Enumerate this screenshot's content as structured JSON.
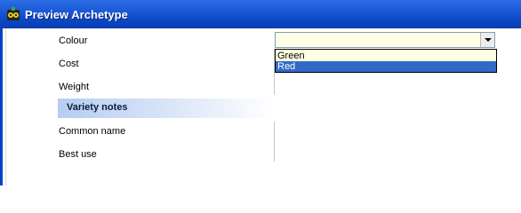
{
  "window": {
    "title": "Preview Archetype",
    "icon": "app-icon",
    "accent_color": "#0a48c6"
  },
  "form": {
    "rows": [
      {
        "label": "Colour"
      },
      {
        "label": "Cost"
      },
      {
        "label": "Weight"
      }
    ],
    "section": {
      "label": "Variety notes"
    },
    "section_rows": [
      {
        "label": "Common name"
      },
      {
        "label": "Best use"
      }
    ]
  },
  "colour_dropdown": {
    "selected_value": "",
    "options": [
      "Green",
      "Red"
    ],
    "highlighted_option": "Red",
    "highlight_color": "#316ac5",
    "icon": "chevron-down-icon"
  }
}
